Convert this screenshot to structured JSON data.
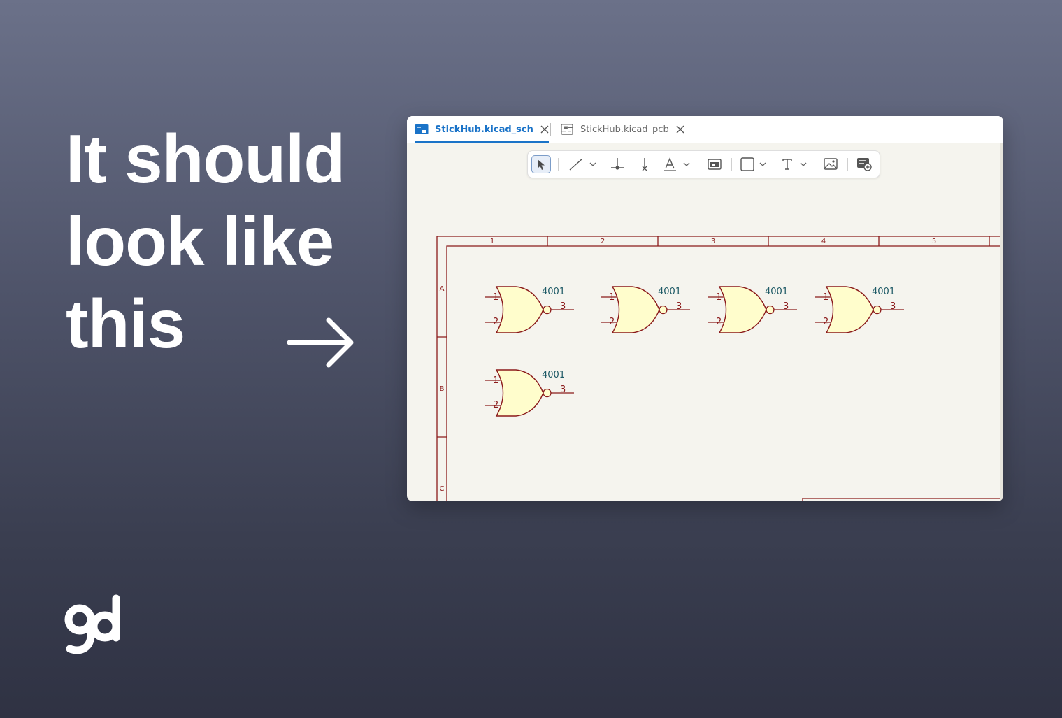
{
  "headline": {
    "line1": "It should",
    "line2": "look like",
    "line3": "this"
  },
  "colors": {
    "accent": "#1a73c8",
    "schematic_line": "#8b1a1a",
    "gate_fill": "#fffdcc",
    "ref_text": "#1e5a66"
  },
  "tabs": [
    {
      "label": "StickHub.kicad_sch",
      "icon": "schematic-icon",
      "active": true
    },
    {
      "label": "StickHub.kicad_pcb",
      "icon": "pcb-icon",
      "active": false
    }
  ],
  "toolbar": {
    "tools": [
      "select-arrow-icon",
      "line-icon",
      "junction-icon",
      "no-connect-icon",
      "label-icon",
      "sheet-icon",
      "rectangle-icon",
      "text-icon",
      "image-icon",
      "add-symbol-icon"
    ]
  },
  "schematic": {
    "columns": [
      "1",
      "2",
      "3",
      "4",
      "5"
    ],
    "rows": [
      "A",
      "B",
      "C"
    ],
    "gates": [
      {
        "ref": "4001",
        "pin1": "1",
        "pin2": "2",
        "pin_out": "3"
      },
      {
        "ref": "4001",
        "pin1": "1",
        "pin2": "2",
        "pin_out": "3"
      },
      {
        "ref": "4001",
        "pin1": "1",
        "pin2": "2",
        "pin_out": "3"
      },
      {
        "ref": "4001",
        "pin1": "1",
        "pin2": "2",
        "pin_out": "3"
      },
      {
        "ref": "4001",
        "pin1": "1",
        "pin2": "2",
        "pin_out": "3"
      }
    ]
  }
}
